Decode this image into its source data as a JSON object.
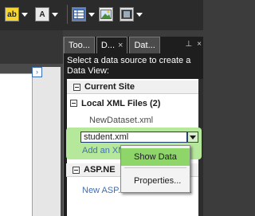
{
  "toolbar": {
    "font_color_icon": "font-highlight-icon",
    "font_style_icon": "font-style-icon",
    "table_icon": "table-grid-icon",
    "image_icon": "picture-icon",
    "media_icon": "film-strip-icon"
  },
  "left_panel": {
    "expand_glyph": "›"
  },
  "panel": {
    "tabs": [
      {
        "label": "Too...",
        "active": false
      },
      {
        "label": "D...",
        "active": true
      },
      {
        "label": "Dat...",
        "active": false
      }
    ],
    "tab_close": "×",
    "pin_glyph": "⊥",
    "panel_close": "×",
    "instructions": "Select a data source to create a Data View:",
    "current_site": "Current Site",
    "local_xml": "Local XML Files (2)",
    "files": [
      "NewDataset.xml",
      "student.xml"
    ],
    "add_link": "Add an XML",
    "asp_net": "ASP.NE",
    "new_link": "New ASP.NET Connection..."
  },
  "context_menu": {
    "items": [
      {
        "label": "Show Data",
        "highlighted": true
      },
      {
        "label": "Properties...",
        "highlighted": false
      }
    ]
  },
  "colors": {
    "highlight_green": "#8fd66a",
    "link_blue": "#3e6fb8",
    "panel_dark": "#1e1e1e"
  }
}
